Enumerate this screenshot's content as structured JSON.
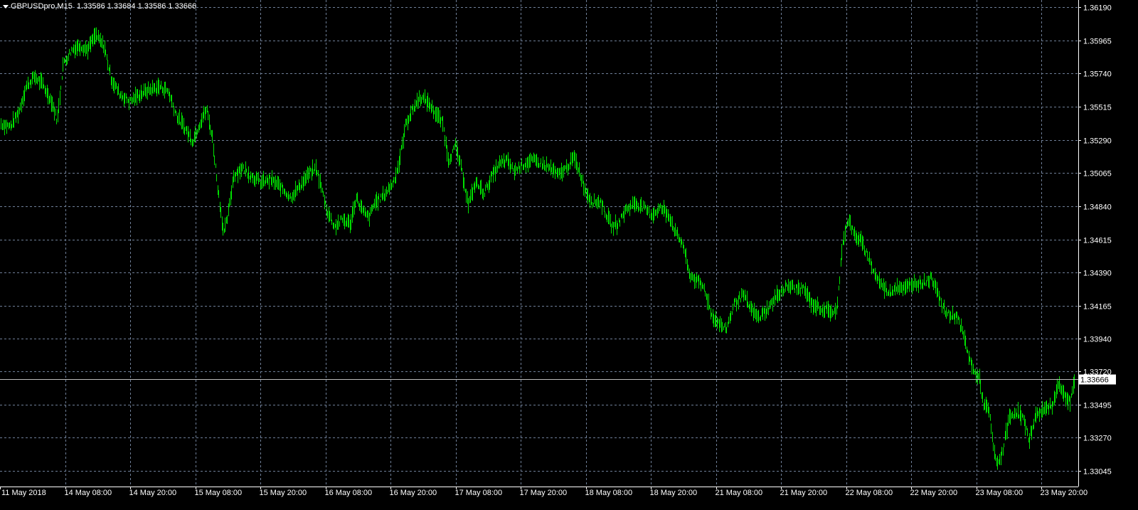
{
  "header": {
    "symbol_label": "GBPUSDpro,M15",
    "ohlc": "1.33586 1.33684 1.33586 1.33666"
  },
  "colors": {
    "background": "#000000",
    "grid": "#6f7f98",
    "bars": "#00e000",
    "text": "#ffffff",
    "price_line": "#bdbdbd",
    "price_badge_bg": "#ffffff"
  },
  "chart_data": {
    "type": "bar",
    "symbol": "GBPUSDpro",
    "timeframe": "M15",
    "ylim": [
      1.3298,
      1.3623
    ],
    "y_ticks": [
      "1.36190",
      "1.35965",
      "1.35740",
      "1.35515",
      "1.35290",
      "1.35065",
      "1.34840",
      "1.34615",
      "1.34390",
      "1.34165",
      "1.33940",
      "1.33720",
      "1.33495",
      "1.33270",
      "1.33045"
    ],
    "x_ticks": [
      "11 May 2018",
      "14 May 08:00",
      "14 May 20:00",
      "15 May 08:00",
      "15 May 20:00",
      "16 May 08:00",
      "16 May 20:00",
      "17 May 08:00",
      "17 May 20:00",
      "18 May 08:00",
      "18 May 20:00",
      "21 May 08:00",
      "21 May 20:00",
      "22 May 08:00",
      "22 May 20:00",
      "23 May 08:00",
      "23 May 20:00"
    ],
    "current_price": "1.33666",
    "grid": true,
    "price_path": [
      [
        0,
        1.354
      ],
      [
        14,
        1.3538
      ],
      [
        26,
        1.3548
      ],
      [
        36,
        1.3565
      ],
      [
        48,
        1.3572
      ],
      [
        60,
        1.3566
      ],
      [
        72,
        1.3555
      ],
      [
        80,
        1.3542
      ],
      [
        88,
        1.358
      ],
      [
        100,
        1.359
      ],
      [
        112,
        1.3593
      ],
      [
        122,
        1.359
      ],
      [
        134,
        1.36
      ],
      [
        146,
        1.3592
      ],
      [
        156,
        1.357
      ],
      [
        168,
        1.356
      ],
      [
        182,
        1.3555
      ],
      [
        196,
        1.356
      ],
      [
        210,
        1.3563
      ],
      [
        224,
        1.3565
      ],
      [
        236,
        1.3562
      ],
      [
        248,
        1.3545
      ],
      [
        262,
        1.3535
      ],
      [
        270,
        1.3528
      ],
      [
        280,
        1.354
      ],
      [
        290,
        1.355
      ],
      [
        298,
        1.353
      ],
      [
        306,
        1.3495
      ],
      [
        314,
        1.3465
      ],
      [
        320,
        1.3478
      ],
      [
        328,
        1.3505
      ],
      [
        340,
        1.351
      ],
      [
        352,
        1.3505
      ],
      [
        366,
        1.35
      ],
      [
        380,
        1.3502
      ],
      [
        394,
        1.3497
      ],
      [
        408,
        1.349
      ],
      [
        420,
        1.3497
      ],
      [
        432,
        1.3505
      ],
      [
        444,
        1.351
      ],
      [
        452,
        1.3495
      ],
      [
        460,
        1.348
      ],
      [
        470,
        1.347
      ],
      [
        480,
        1.3475
      ],
      [
        492,
        1.3472
      ],
      [
        500,
        1.349
      ],
      [
        510,
        1.348
      ],
      [
        518,
        1.3476
      ],
      [
        526,
        1.3486
      ],
      [
        540,
        1.3492
      ],
      [
        552,
        1.35
      ],
      [
        560,
        1.3512
      ],
      [
        570,
        1.354
      ],
      [
        580,
        1.355
      ],
      [
        590,
        1.3558
      ],
      [
        600,
        1.3555
      ],
      [
        612,
        1.3547
      ],
      [
        622,
        1.354
      ],
      [
        630,
        1.3515
      ],
      [
        640,
        1.3525
      ],
      [
        650,
        1.3505
      ],
      [
        658,
        1.3485
      ],
      [
        668,
        1.35
      ],
      [
        680,
        1.3493
      ],
      [
        690,
        1.3503
      ],
      [
        700,
        1.3512
      ],
      [
        712,
        1.3515
      ],
      [
        722,
        1.3508
      ],
      [
        734,
        1.3512
      ],
      [
        748,
        1.3515
      ],
      [
        760,
        1.3513
      ],
      [
        772,
        1.351
      ],
      [
        784,
        1.3505
      ],
      [
        796,
        1.351
      ],
      [
        806,
        1.3517
      ],
      [
        814,
        1.3508
      ],
      [
        822,
        1.3495
      ],
      [
        832,
        1.3487
      ],
      [
        844,
        1.3487
      ],
      [
        852,
        1.3478
      ],
      [
        860,
        1.347
      ],
      [
        868,
        1.3472
      ],
      [
        880,
        1.3482
      ],
      [
        892,
        1.3486
      ],
      [
        904,
        1.3483
      ],
      [
        916,
        1.3478
      ],
      [
        928,
        1.3483
      ],
      [
        940,
        1.3478
      ],
      [
        950,
        1.3465
      ],
      [
        960,
        1.3458
      ],
      [
        968,
        1.3438
      ],
      [
        980,
        1.3433
      ],
      [
        990,
        1.3428
      ],
      [
        1000,
        1.341
      ],
      [
        1010,
        1.3405
      ],
      [
        1020,
        1.34
      ],
      [
        1032,
        1.3418
      ],
      [
        1044,
        1.3424
      ],
      [
        1054,
        1.3415
      ],
      [
        1066,
        1.3408
      ],
      [
        1080,
        1.3415
      ],
      [
        1094,
        1.3425
      ],
      [
        1108,
        1.343
      ],
      [
        1120,
        1.3428
      ],
      [
        1130,
        1.3428
      ],
      [
        1140,
        1.3418
      ],
      [
        1152,
        1.3415
      ],
      [
        1164,
        1.3413
      ],
      [
        1176,
        1.3412
      ],
      [
        1184,
        1.346
      ],
      [
        1192,
        1.3475
      ],
      [
        1200,
        1.3465
      ],
      [
        1210,
        1.346
      ],
      [
        1220,
        1.345
      ],
      [
        1230,
        1.3437
      ],
      [
        1240,
        1.343
      ],
      [
        1250,
        1.3425
      ],
      [
        1260,
        1.343
      ],
      [
        1272,
        1.3428
      ],
      [
        1284,
        1.3432
      ],
      [
        1296,
        1.3432
      ],
      [
        1308,
        1.3435
      ],
      [
        1316,
        1.343
      ],
      [
        1324,
        1.3415
      ],
      [
        1334,
        1.341
      ],
      [
        1344,
        1.341
      ],
      [
        1352,
        1.34
      ],
      [
        1360,
        1.3385
      ],
      [
        1368,
        1.3372
      ],
      [
        1376,
        1.3368
      ],
      [
        1382,
        1.335
      ],
      [
        1390,
        1.3345
      ],
      [
        1396,
        1.332
      ],
      [
        1402,
        1.3308
      ],
      [
        1410,
        1.332
      ],
      [
        1418,
        1.334
      ],
      [
        1428,
        1.3345
      ],
      [
        1438,
        1.334
      ],
      [
        1446,
        1.3325
      ],
      [
        1454,
        1.334
      ],
      [
        1462,
        1.3345
      ],
      [
        1472,
        1.3347
      ],
      [
        1480,
        1.335
      ],
      [
        1488,
        1.3365
      ],
      [
        1496,
        1.3355
      ],
      [
        1504,
        1.3352
      ],
      [
        1510,
        1.3366
      ]
    ]
  }
}
